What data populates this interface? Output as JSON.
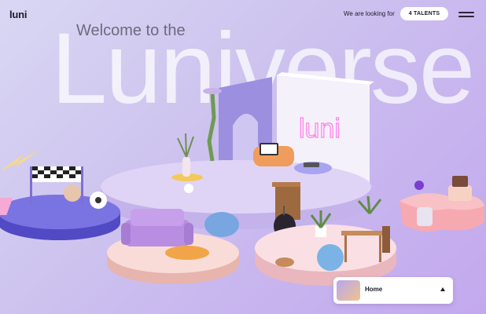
{
  "header": {
    "logo": "luni",
    "looking_text": "We are looking for",
    "talents_button": "4 TALENTS",
    "menu_icon": "hamburger-menu-icon"
  },
  "hero": {
    "welcome": "Welcome to the",
    "big_word": "Luniverse",
    "neon_sign": "luni"
  },
  "nav": {
    "current": "Home",
    "caret_icon": "caret-up-icon"
  },
  "colors": {
    "lilac": "#c9b9ef",
    "platform_purple": "#6a63d8",
    "platform_pink": "#f2c9c4",
    "white": "#ffffff"
  }
}
